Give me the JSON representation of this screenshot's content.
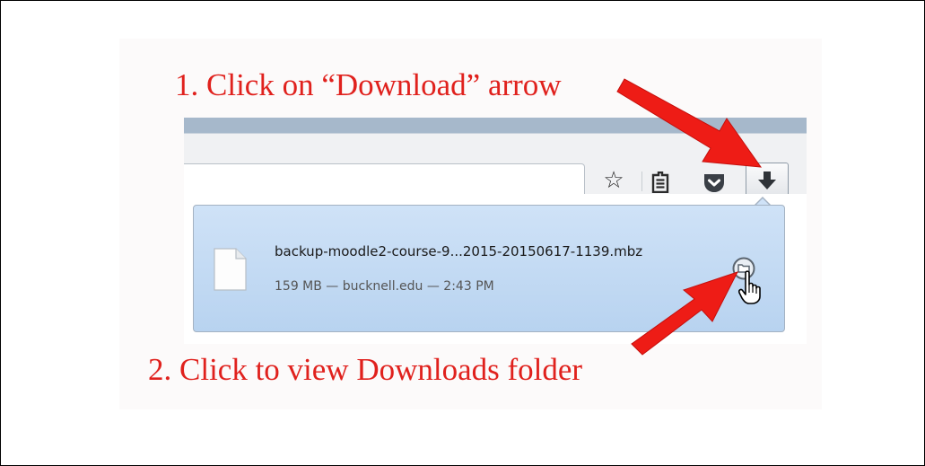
{
  "annotations": {
    "step1": "1. Click on “Download” arrow",
    "step2": "2. Click to view Downloads folder"
  },
  "colors": {
    "annotation_red": "#e0211d",
    "popup_blue": "#c3dbf4"
  },
  "toolbar": {
    "icons": [
      "star-icon",
      "reading-list-icon",
      "pocket-icon",
      "download-arrow-icon"
    ]
  },
  "download": {
    "filename": "backup-moodle2-course-9...2015-20150617-1139.mbz",
    "meta": "159 MB — bucknell.edu — 2:43 PM",
    "icons": [
      "file-icon",
      "open-folder-icon"
    ]
  }
}
